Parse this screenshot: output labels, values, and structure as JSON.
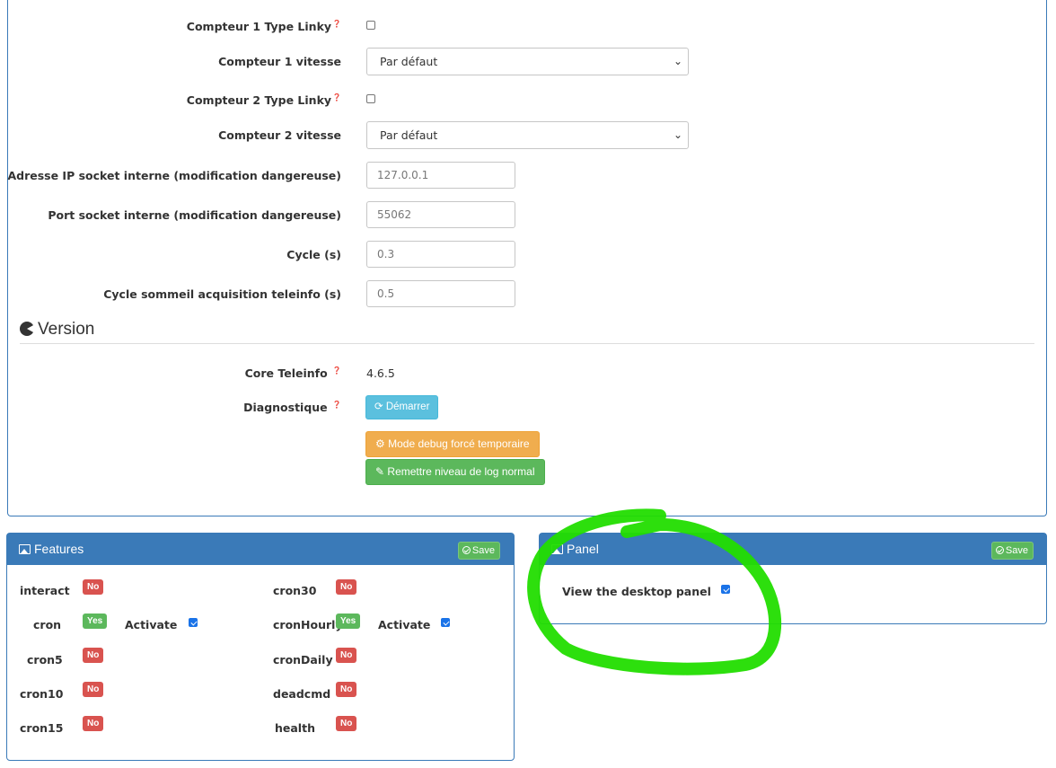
{
  "config": {
    "compteur1_linky_label": "Compteur 1 Type Linky",
    "compteur1_linky_checked": false,
    "compteur1_vitesse_label": "Compteur 1 vitesse",
    "compteur1_vitesse_value": "Par défaut",
    "compteur2_linky_label": "Compteur 2 Type Linky",
    "compteur2_linky_checked": false,
    "compteur2_vitesse_label": "Compteur 2 vitesse",
    "compteur2_vitesse_value": "Par défaut",
    "socket_ip_label": "Adresse IP socket interne (modification dangereuse)",
    "socket_ip_placeholder": "127.0.0.1",
    "socket_port_label": "Port socket interne (modification dangereuse)",
    "socket_port_placeholder": "55062",
    "cycle_label": "Cycle (s)",
    "cycle_placeholder": "0.3",
    "cycle_sommeil_label": "Cycle sommeil acquisition teleinfo (s)",
    "cycle_sommeil_placeholder": "0.5"
  },
  "version": {
    "title": "Version",
    "core_label": "Core Teleinfo",
    "core_value": "4.6.5",
    "diagnostic_label": "Diagnostique",
    "start_button": "Démarrer",
    "debug_button": "Mode debug forcé temporaire",
    "log_button": "Remettre niveau de log normal"
  },
  "features": {
    "title": "Features",
    "save_label": "Save",
    "activate_label": "Activate",
    "items": [
      {
        "name": "interact",
        "status": "No"
      },
      {
        "name": "cron30",
        "status": "No"
      },
      {
        "name": "cron",
        "status": "Yes",
        "activate": true
      },
      {
        "name": "cronHourly",
        "status": "Yes",
        "activate": true
      },
      {
        "name": "cron5",
        "status": "No"
      },
      {
        "name": "cronDaily",
        "status": "No"
      },
      {
        "name": "cron10",
        "status": "No"
      },
      {
        "name": "deadcmd",
        "status": "No"
      },
      {
        "name": "cron15",
        "status": "No"
      },
      {
        "name": "health",
        "status": "No"
      }
    ]
  },
  "panel": {
    "title": "Panel",
    "save_label": "Save",
    "desktop_label": "View the desktop panel",
    "desktop_checked": true
  },
  "colors": {
    "panel_header": "#3a7ab8",
    "badge_no": "#d9534f",
    "badge_yes": "#5cb85c",
    "highlight": "#22dd00"
  },
  "icons": {
    "help": "question-circle-icon",
    "version": "pacman-icon",
    "panel_header": "image-icon",
    "save": "check-circle-icon",
    "start": "refresh-icon",
    "debug": "cogs-icon",
    "log": "eraser-icon"
  }
}
